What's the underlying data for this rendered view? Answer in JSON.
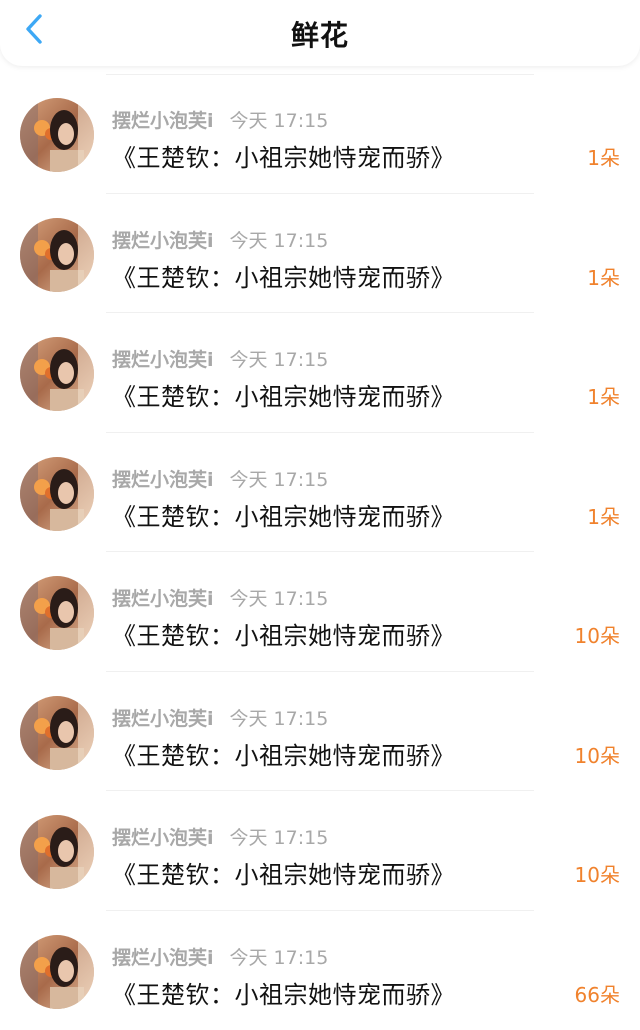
{
  "header": {
    "title": "鲜花",
    "back_icon": "chevron-left-icon",
    "accent_color": "#3da8f5"
  },
  "list": {
    "items": [
      {
        "nickname": "摆烂小泡芙i",
        "time": "今天 17:15",
        "book": "《王楚钦：小祖宗她恃宠而骄》",
        "amount": "1朵"
      },
      {
        "nickname": "摆烂小泡芙i",
        "time": "今天 17:15",
        "book": "《王楚钦：小祖宗她恃宠而骄》",
        "amount": "1朵"
      },
      {
        "nickname": "摆烂小泡芙i",
        "time": "今天 17:15",
        "book": "《王楚钦：小祖宗她恃宠而骄》",
        "amount": "1朵"
      },
      {
        "nickname": "摆烂小泡芙i",
        "time": "今天 17:15",
        "book": "《王楚钦：小祖宗她恃宠而骄》",
        "amount": "1朵"
      },
      {
        "nickname": "摆烂小泡芙i",
        "time": "今天 17:15",
        "book": "《王楚钦：小祖宗她恃宠而骄》",
        "amount": "10朵"
      },
      {
        "nickname": "摆烂小泡芙i",
        "time": "今天 17:15",
        "book": "《王楚钦：小祖宗她恃宠而骄》",
        "amount": "10朵"
      },
      {
        "nickname": "摆烂小泡芙i",
        "time": "今天 17:15",
        "book": "《王楚钦：小祖宗她恃宠而骄》",
        "amount": "10朵"
      },
      {
        "nickname": "摆烂小泡芙i",
        "time": "今天 17:15",
        "book": "《王楚钦：小祖宗她恃宠而骄》",
        "amount": "66朵"
      }
    ]
  },
  "colors": {
    "amount": "#f0822d",
    "meta": "#a8a8a8",
    "title_text": "#121212"
  }
}
